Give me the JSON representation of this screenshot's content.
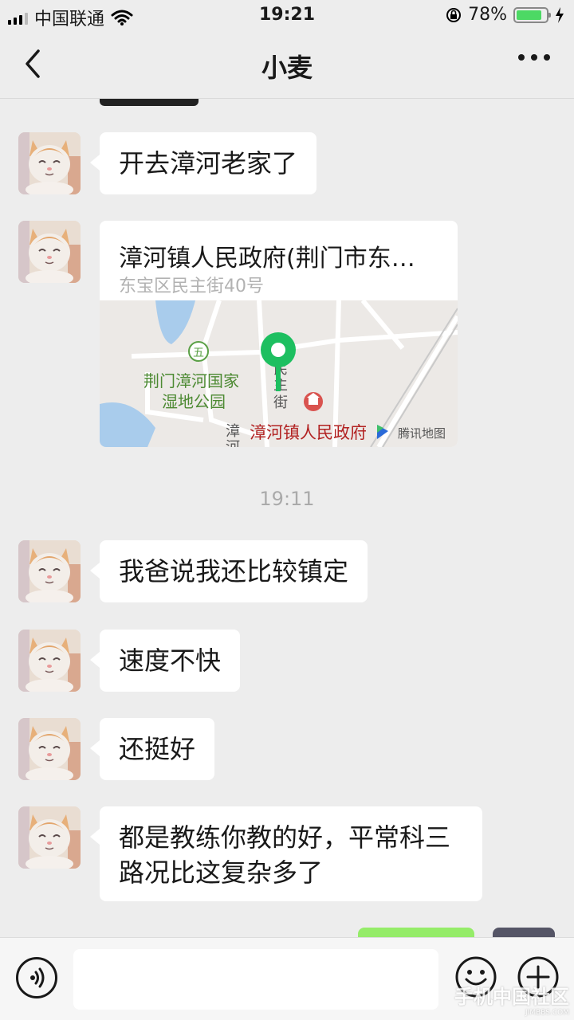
{
  "status_bar": {
    "carrier": "中国联通",
    "time": "19:21",
    "battery": "78%",
    "battery_level": 0.78
  },
  "header": {
    "title": "小麦"
  },
  "messages": [
    {
      "text": "开去漳河老家了"
    },
    {
      "location": {
        "title": "漳河镇人民政府(荆门市东…",
        "address": "东宝区民主街40号",
        "map_labels": {
          "park_line1": "荆门漳河国家",
          "park_line2": "湿地公园",
          "street_a": "民",
          "street_b": "主",
          "street_c": "街",
          "street_d": "漳",
          "street_e": "河",
          "poi": "漳河镇人民政府",
          "provider": "腾讯地图"
        }
      }
    },
    {
      "text": "我爸说我还比较镇定"
    },
    {
      "text": "速度不快"
    },
    {
      "text": "还挺好"
    },
    {
      "text": "都是教练你教的好，平常科三路况比这复杂多了"
    }
  ],
  "timestamp": "19:11",
  "watermark": {
    "main": "手机中国社区",
    "sub": "JIMBBS.COM"
  },
  "icons": {
    "back": "chevron-left-icon",
    "more": "more-dots-icon",
    "voice": "voice-icon",
    "emoji": "emoji-icon",
    "plus": "plus-icon"
  },
  "colors": {
    "background": "#ededed",
    "bubble_in": "#ffffff",
    "bubble_out": "#95ec69",
    "map_pin": "#1dbf60",
    "poi_text": "#b22222"
  }
}
